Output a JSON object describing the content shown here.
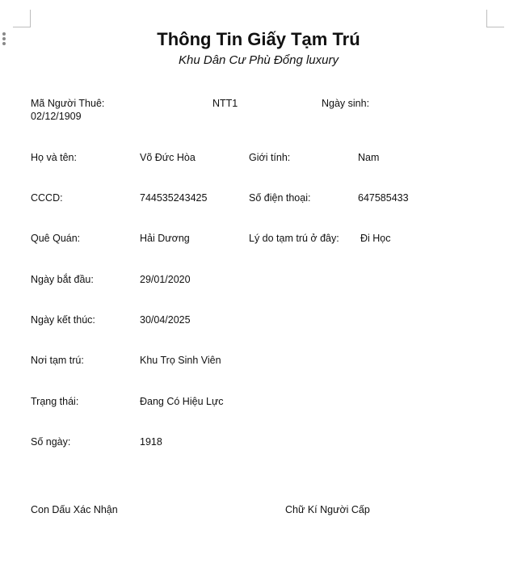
{
  "header": {
    "title": "Thông Tin Giấy Tạm Trú",
    "subtitle": "Khu Dân Cư Phù Đổng luxury"
  },
  "first_row": {
    "id_label": "Mã Người Thuê:",
    "id_value": "NTT1",
    "dob_label": "Ngày sinh:",
    "dob_value": "02/12/1909"
  },
  "rows": [
    {
      "label": "Họ và tên:",
      "value": "Võ Đức Hòa",
      "label2": "Giới tính:",
      "value2": "Nam"
    },
    {
      "label": "CCCD:",
      "value": "744535243425",
      "label2": "Số điện thoại:",
      "value2": "647585433"
    },
    {
      "label": "Quê Quán:",
      "value": "Hải Dương",
      "label2": "Lý do tạm trú ở đây:",
      "value2": "Đi Học"
    },
    {
      "label": "Ngày bắt đầu:",
      "value": "29/01/2020"
    },
    {
      "label": "Ngày kết thúc:",
      "value": "30/04/2025"
    },
    {
      "label": "Nơi tạm trú:",
      "value": "Khu Trọ Sinh Viên"
    },
    {
      "label": "Trạng thái:",
      "value": "Đang Có Hiệu Lực"
    },
    {
      "label": "Số ngày:",
      "value": "1918"
    }
  ],
  "footer": {
    "stamp_label": "Con Dấu Xác Nhận",
    "signature_label": "Chữ Kí Người Cấp"
  }
}
